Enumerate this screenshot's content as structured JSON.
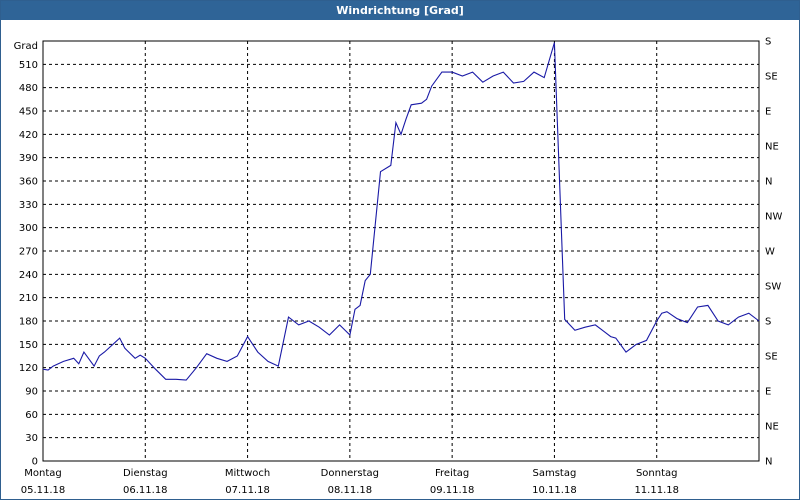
{
  "window_title": "Windrichtung [Grad]",
  "colors": {
    "titlebar": "#2f6497",
    "line": "#1a1aa6",
    "grid": "#000000"
  },
  "chart_data": {
    "type": "line",
    "title": "Windrichtung [Grad]",
    "ylabel": "Grad",
    "ylim": [
      0,
      540
    ],
    "yticks": [
      0,
      30,
      60,
      90,
      120,
      150,
      180,
      210,
      240,
      270,
      300,
      330,
      360,
      390,
      420,
      450,
      480,
      510
    ],
    "right_axis_labels": [
      "N",
      "NE",
      "E",
      "SE",
      "S",
      "SW",
      "W",
      "NW",
      "N",
      "NE",
      "E",
      "SE",
      "S"
    ],
    "x_days": [
      {
        "day": "Montag",
        "date": "05.11.18"
      },
      {
        "day": "Dienstag",
        "date": "06.11.18"
      },
      {
        "day": "Mittwoch",
        "date": "07.11.18"
      },
      {
        "day": "Donnerstag",
        "date": "08.11.18"
      },
      {
        "day": "Freitag",
        "date": "09.11.18"
      },
      {
        "day": "Samstag",
        "date": "10.11.18"
      },
      {
        "day": "Sonntag",
        "date": "11.11.18"
      }
    ],
    "xlim": [
      0,
      7
    ],
    "grid": true,
    "series": [
      {
        "x": [
          0,
          0.05,
          0.1,
          0.2,
          0.3,
          0.35,
          0.4,
          0.5,
          0.55,
          0.6,
          0.7,
          0.75,
          0.8,
          0.9,
          0.95,
          1.0,
          1.1,
          1.2,
          1.3,
          1.4,
          1.5,
          1.6,
          1.7,
          1.8,
          1.9,
          2.0,
          2.1,
          2.2,
          2.3,
          2.4,
          2.5,
          2.6,
          2.7,
          2.8,
          2.9,
          3.0,
          3.05,
          3.1,
          3.15,
          3.2,
          3.3,
          3.4,
          3.45,
          3.5,
          3.55,
          3.6,
          3.7,
          3.75,
          3.8,
          3.9,
          4.0,
          4.1,
          4.2,
          4.3,
          4.4,
          4.5,
          4.6,
          4.7,
          4.8,
          4.9,
          5.0,
          5.1,
          5.2,
          5.3,
          5.4,
          5.45,
          5.5,
          5.55,
          5.6,
          5.7,
          5.8,
          5.9,
          6.0,
          6.05,
          6.1,
          6.2,
          6.3,
          6.4,
          6.5,
          6.6,
          6.7,
          6.8,
          6.9,
          7.0
        ],
        "y": [
          118,
          117,
          122,
          128,
          132,
          125,
          140,
          122,
          135,
          140,
          152,
          158,
          145,
          132,
          136,
          132,
          118,
          105,
          105,
          104,
          120,
          138,
          132,
          128,
          135,
          160,
          140,
          128,
          122,
          185,
          175,
          180,
          172,
          162,
          175,
          162,
          195,
          200,
          232,
          240,
          372,
          380,
          435,
          420,
          440,
          458,
          460,
          465,
          482,
          500,
          500,
          495,
          500,
          487,
          495,
          500,
          486,
          488,
          500,
          493,
          538,
          182,
          168,
          172,
          175,
          170,
          165,
          160,
          158,
          140,
          150,
          155,
          180,
          190,
          192,
          183,
          178,
          198,
          200,
          180,
          175,
          185,
          190,
          180
        ],
        "ylabels_note": "",
        "name": ""
      }
    ]
  }
}
